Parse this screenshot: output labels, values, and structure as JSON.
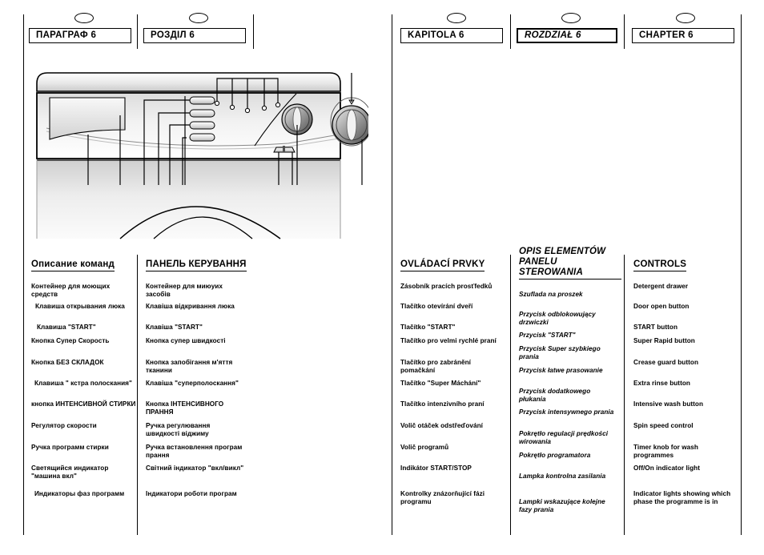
{
  "headers": [
    {
      "label": "ПАРАГРАФ 6",
      "italic": false
    },
    {
      "label": "РОЗДІЛ 6",
      "italic": false
    },
    {
      "label": "KAPITOLA 6",
      "italic": false
    },
    {
      "label": "ROZDZIAŁ 6",
      "italic": true
    },
    {
      "label": "CHAPTER 6",
      "italic": false
    }
  ],
  "columns": [
    {
      "id": "russian",
      "title": "Описание команд",
      "italic": false,
      "items": [
        "Контейнер для моющих\nсредств",
        "Клавиша открывания люка",
        "Клавиша \"START\"",
        "Кнопка Супер Скорость",
        "Кнопка БЕЗ СКЛАДОК",
        "Клавиша \" кстра полоскания\"",
        "кнопка ИНТЕНСИВНОЙ СТИРКИ",
        "Регулятор скорости",
        "Ручка программ стирки",
        "Светящийся индикатор\n\"машина вкл\"",
        "Индикаторы фаз программ"
      ]
    },
    {
      "id": "ukrainian",
      "title": "ПАНЕЛЬ КЕРУВАННЯ",
      "italic": false,
      "items": [
        "Контейнер для миюуих\nзасобів",
        "Клавіша відкривання люка",
        "Клавіша \"START\"",
        "Кнопка супер швидкості",
        "Кнопка запобігання м'яття\nтканини",
        "Клавіша \"суперполоскання\"",
        "Кнопка ІНТЕНСИВНОГО ПРАННЯ",
        "Ручка регулювання\nшвидкості віджиму",
        "Ручка встановлення програм\nпрання",
        "Світний індикатор \"вкл/викл\"",
        "Індикатори роботи програм"
      ]
    },
    {
      "id": "czech",
      "title": "OVLÁDACÍ PRVKY",
      "italic": false,
      "items": [
        "Zásobník pracích prosťfedků",
        "Tlačítko otevírání dveří",
        "Tlačítko \"START\"",
        "Tlačítko pro velmi rychlé praní",
        "Tlačítko pro zabránění\npomačkání",
        "Tlačítko \"Super Máchání\"",
        "Tlačítko intenzivního praní",
        "Volič otáček odstřeďování",
        "Volič programů",
        "Indikátor START/STOP",
        "Kontrolky znázorňující fázi\nprogramu"
      ]
    },
    {
      "id": "polish",
      "title": "OPIS ELEMENTÓW\nPANELU STEROWANIA",
      "italic": true,
      "items": [
        "Szuflada na proszek",
        "Przycisk odblokowujący\ndrzwiczki",
        "Przycisk \"START\"",
        "Przycisk Super szybkiego\nprania",
        "Przycisk łatwe prasowanie",
        "Przycisk dodatkowego\npłukania",
        "Przycisk intensywnego prania",
        "Pokrętło regulacji prędkości\nwirowania",
        "Pokrętło programatora",
        "Lampka kontrolna zasilania",
        "Lampki wskazujące kolejne\nfazy prania"
      ]
    },
    {
      "id": "english",
      "title": "CONTROLS",
      "italic": false,
      "items": [
        "Detergent drawer",
        "Door open button",
        "START button",
        "Super Rapid button",
        "Crease guard button",
        "Extra rinse button",
        "Intensive wash button",
        "Spin speed control",
        "Timer knob for wash\nprogrammes",
        "Off/On indicator light",
        "Indicator lights showing which\nphase the programme is in"
      ]
    }
  ],
  "illustration": {
    "name": "washing-machine-control-panel-diagram"
  }
}
